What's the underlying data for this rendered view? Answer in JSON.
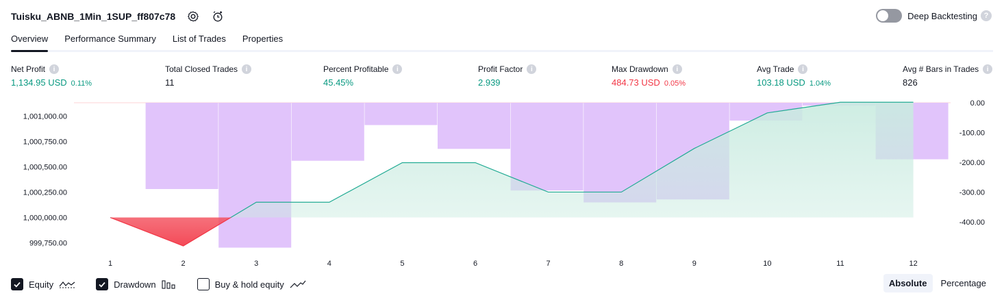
{
  "header": {
    "strategy_name": "Tuisku_ABNB_1Min_1SUP_ff807c78",
    "icons": [
      "settings-icon",
      "add-alert-icon"
    ]
  },
  "deep_backtesting": {
    "label": "Deep Backtesting",
    "enabled": false
  },
  "tabs": [
    {
      "label": "Overview",
      "active": true
    },
    {
      "label": "Performance Summary",
      "active": false
    },
    {
      "label": "List of Trades",
      "active": false
    },
    {
      "label": "Properties",
      "active": false
    }
  ],
  "metrics": {
    "net_profit": {
      "label": "Net Profit",
      "value": "1,134.95 USD",
      "pct": "0.11%"
    },
    "total_closed_trades": {
      "label": "Total Closed Trades",
      "value": "11"
    },
    "percent_profitable": {
      "label": "Percent Profitable",
      "value": "45.45%"
    },
    "profit_factor": {
      "label": "Profit Factor",
      "value": "2.939"
    },
    "max_drawdown": {
      "label": "Max Drawdown",
      "value": "484.73 USD",
      "pct": "0.05%"
    },
    "avg_trade": {
      "label": "Avg Trade",
      "value": "103.18 USD",
      "pct": "1.04%"
    },
    "avg_bars": {
      "label": "Avg # Bars in Trades",
      "value": "826"
    }
  },
  "colors": {
    "positive": "#089981",
    "negative": "#f23645",
    "equity_line": "#22ab94",
    "drawdown_bar": "#e1c4fb",
    "equity_fill": "#c9ebe0"
  },
  "chart_data": {
    "type": "line",
    "x": [
      1,
      2,
      3,
      4,
      5,
      6,
      7,
      8,
      9,
      10,
      11,
      12
    ],
    "left_axis": {
      "ticks": [
        "1,001,000.00",
        "1,000,750.00",
        "1,000,500.00",
        "1,000,250.00",
        "1,000,000.00",
        "999,750.00"
      ],
      "range": [
        999700,
        1001130
      ]
    },
    "right_axis": {
      "ticks": [
        "0.00",
        "-100.00",
        "-200.00",
        "-300.00",
        "-400.00"
      ],
      "range": [
        -488,
        0
      ]
    },
    "series": [
      {
        "name": "Equity",
        "values": [
          1000000,
          999720,
          1000150,
          1000150,
          1000540,
          1000540,
          1000250,
          1000250,
          1000680,
          1001030,
          1001135,
          1001135
        ]
      },
      {
        "name": "Drawdown",
        "values": [
          0,
          -290,
          -487,
          -195,
          -75,
          -155,
          -295,
          -335,
          -325,
          -60,
          -10,
          -190
        ]
      }
    ]
  },
  "legend": {
    "items": [
      {
        "label": "Equity",
        "checked": true
      },
      {
        "label": "Drawdown",
        "checked": true
      },
      {
        "label": "Buy & hold equity",
        "checked": false
      }
    ]
  },
  "mode": {
    "absolute": "Absolute",
    "percentage": "Percentage",
    "selected": "Absolute"
  }
}
